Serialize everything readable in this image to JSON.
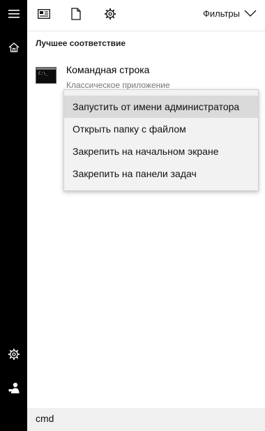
{
  "rail": {
    "icons": [
      "hamburger-icon",
      "home-icon",
      "settings-icon",
      "feedback-icon"
    ]
  },
  "topbar": {
    "icons": [
      "news-icon",
      "document-icon",
      "settings-icon"
    ],
    "filters_label": "Фильтры"
  },
  "best_match": {
    "section_title": "Лучшее соответствие",
    "result_title": "Командная строка",
    "result_subtitle": "Классическое приложение",
    "icon_text": "C:\\_"
  },
  "context_menu": {
    "items": [
      {
        "label": "Запустить от имени администратора",
        "active": true
      },
      {
        "label": "Открыть папку с файлом"
      },
      {
        "label": "Закрепить на начальном экране"
      },
      {
        "label": "Закрепить на панели задач"
      }
    ]
  },
  "search": {
    "value": "cmd"
  }
}
